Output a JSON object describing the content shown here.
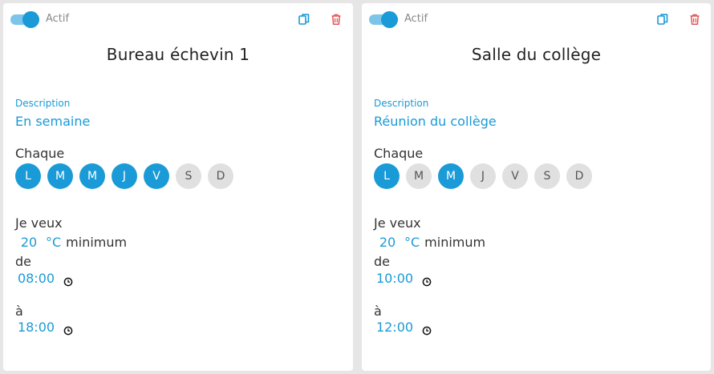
{
  "schedules": [
    {
      "active_label": "Actif",
      "title": "Bureau échevin 1",
      "description_label": "Description",
      "description": "En semaine",
      "every_label": "Chaque",
      "days": [
        {
          "label": "L",
          "active": true
        },
        {
          "label": "M",
          "active": true
        },
        {
          "label": "M",
          "active": true
        },
        {
          "label": "J",
          "active": true
        },
        {
          "label": "V",
          "active": true
        },
        {
          "label": "S",
          "active": false
        },
        {
          "label": "D",
          "active": false
        }
      ],
      "want_label": "Je veux",
      "temperature": "20",
      "unit": "°C",
      "minimum_label": "minimum",
      "from_label": "de",
      "from_time": "08:00",
      "to_label": "à",
      "to_time": "18:00"
    },
    {
      "active_label": "Actif",
      "title": "Salle du collège",
      "description_label": "Description",
      "description": "Réunion du collège",
      "every_label": "Chaque",
      "days": [
        {
          "label": "L",
          "active": true
        },
        {
          "label": "M",
          "active": false
        },
        {
          "label": "M",
          "active": true
        },
        {
          "label": "J",
          "active": false
        },
        {
          "label": "V",
          "active": false
        },
        {
          "label": "S",
          "active": false
        },
        {
          "label": "D",
          "active": false
        }
      ],
      "want_label": "Je veux",
      "temperature": "20",
      "unit": "°C",
      "minimum_label": "minimum",
      "from_label": "de",
      "from_time": "10:00",
      "to_label": "à",
      "to_time": "12:00"
    }
  ],
  "colors": {
    "accent": "#1a9ad6",
    "toggle_track": "#7cc4ea",
    "day_inactive": "#e0e0e0",
    "delete": "#e05555"
  },
  "icons": {
    "copy": "copy-icon",
    "delete": "trash-icon",
    "clock": "clock-icon"
  }
}
